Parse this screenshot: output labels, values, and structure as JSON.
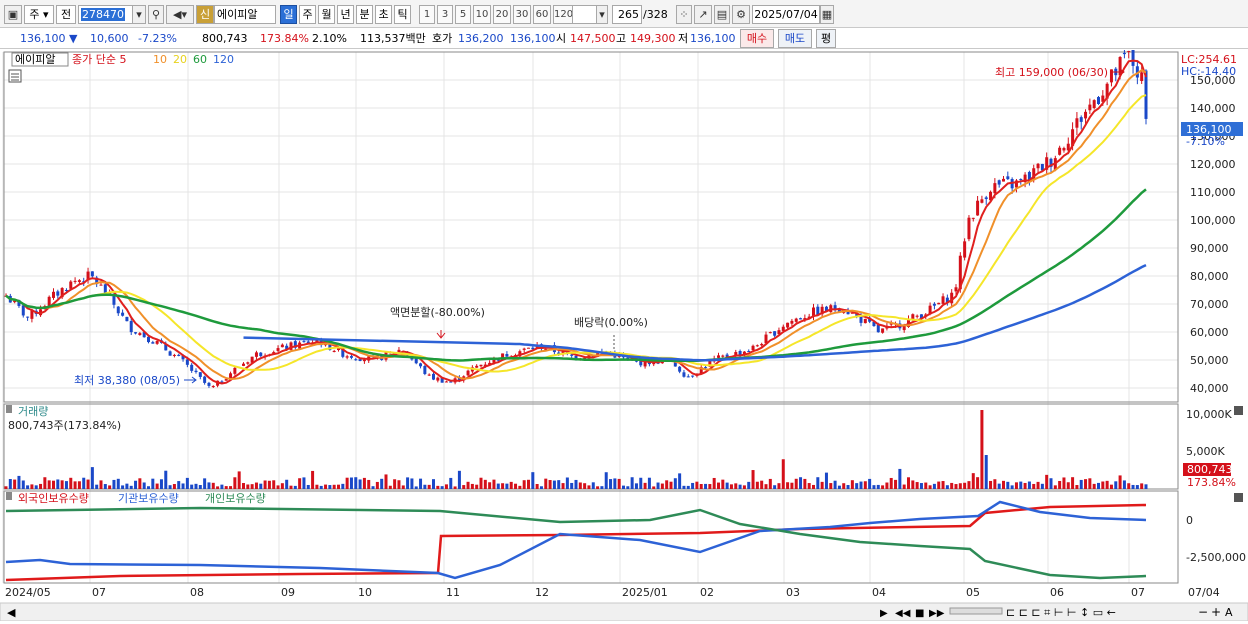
{
  "toolbar": {
    "market": "주",
    "prev": "전",
    "code": "278470",
    "stock_name": "에이피알",
    "periods": [
      "일",
      "주",
      "월",
      "년",
      "분",
      "초",
      "틱"
    ],
    "minutes": [
      "1",
      "3",
      "5",
      "10",
      "20",
      "30",
      "60",
      "120"
    ],
    "count": "265",
    "count_total": "/328",
    "date": "2025/07/04"
  },
  "quote": {
    "price": "136,100",
    "change": "10,600",
    "change_pct": "-7.23%",
    "volume": "800,743",
    "volume_pct": "173.84%",
    "turnover_pct": "2.10%",
    "amount": "113,537백만",
    "bid_label": "호가",
    "bid1": "136,200",
    "bid2": "136,100",
    "open_label": "시",
    "open": "147,500",
    "high_label": "고",
    "high": "149,300",
    "low_label": "저",
    "low": "136,100",
    "buy": "매수",
    "sell": "매도",
    "eval": "평"
  },
  "legend": {
    "name": "에이피알",
    "series_label": "종가 단순",
    "ma5": "5",
    "ma10": "10",
    "ma20": "20",
    "ma60": "60",
    "ma120": "120"
  },
  "annotations": {
    "lc": "LC:254.61",
    "hc": "HC:-14.40",
    "high_mark": "최고 159,000 (06/30)",
    "low_mark": "최저 38,380 (08/05)",
    "split": "액면분할(-80.00%)",
    "dividend": "배당락(0.00%)",
    "last_price": "136,100",
    "last_pct": "-7.10%"
  },
  "volume_panel": {
    "title": "거래량",
    "summary": "800,743주(173.84%)",
    "axis": [
      "10,000K",
      "5,000K"
    ],
    "last": "800,743",
    "last_pct": "173.84%"
  },
  "holdings_panel": {
    "foreign": "외국인보유수량",
    "institution": "기관보유수량",
    "individual": "개인보유수량",
    "axis": [
      "0",
      "-2,500,000"
    ]
  },
  "colors": {
    "up": "#d4101a",
    "down": "#1a48c8",
    "ma5": "#e0201e",
    "ma10": "#f0902a",
    "ma20": "#f5e62a",
    "ma60": "#1e9a3c",
    "ma120": "#2d62d6",
    "foreign": "#e01a1a",
    "institution": "#2d62d6",
    "individual": "#2e8b57"
  },
  "chart_data": {
    "type": "candlestick",
    "price_axis": [
      "150,000",
      "140,000",
      "130,000",
      "120,000",
      "110,000",
      "100,000",
      "90,000",
      "80,000",
      "70,000",
      "60,000",
      "50,000",
      "40,000"
    ],
    "ylim": [
      35000,
      160000
    ],
    "x_labels": [
      "2024/05",
      "07",
      "08",
      "09",
      "10",
      "11",
      "12",
      "2025/01",
      "02",
      "03",
      "04",
      "05",
      "06",
      "07",
      "07/04"
    ],
    "last_close": 136100,
    "period_high": 159000,
    "period_low": 38380
  }
}
